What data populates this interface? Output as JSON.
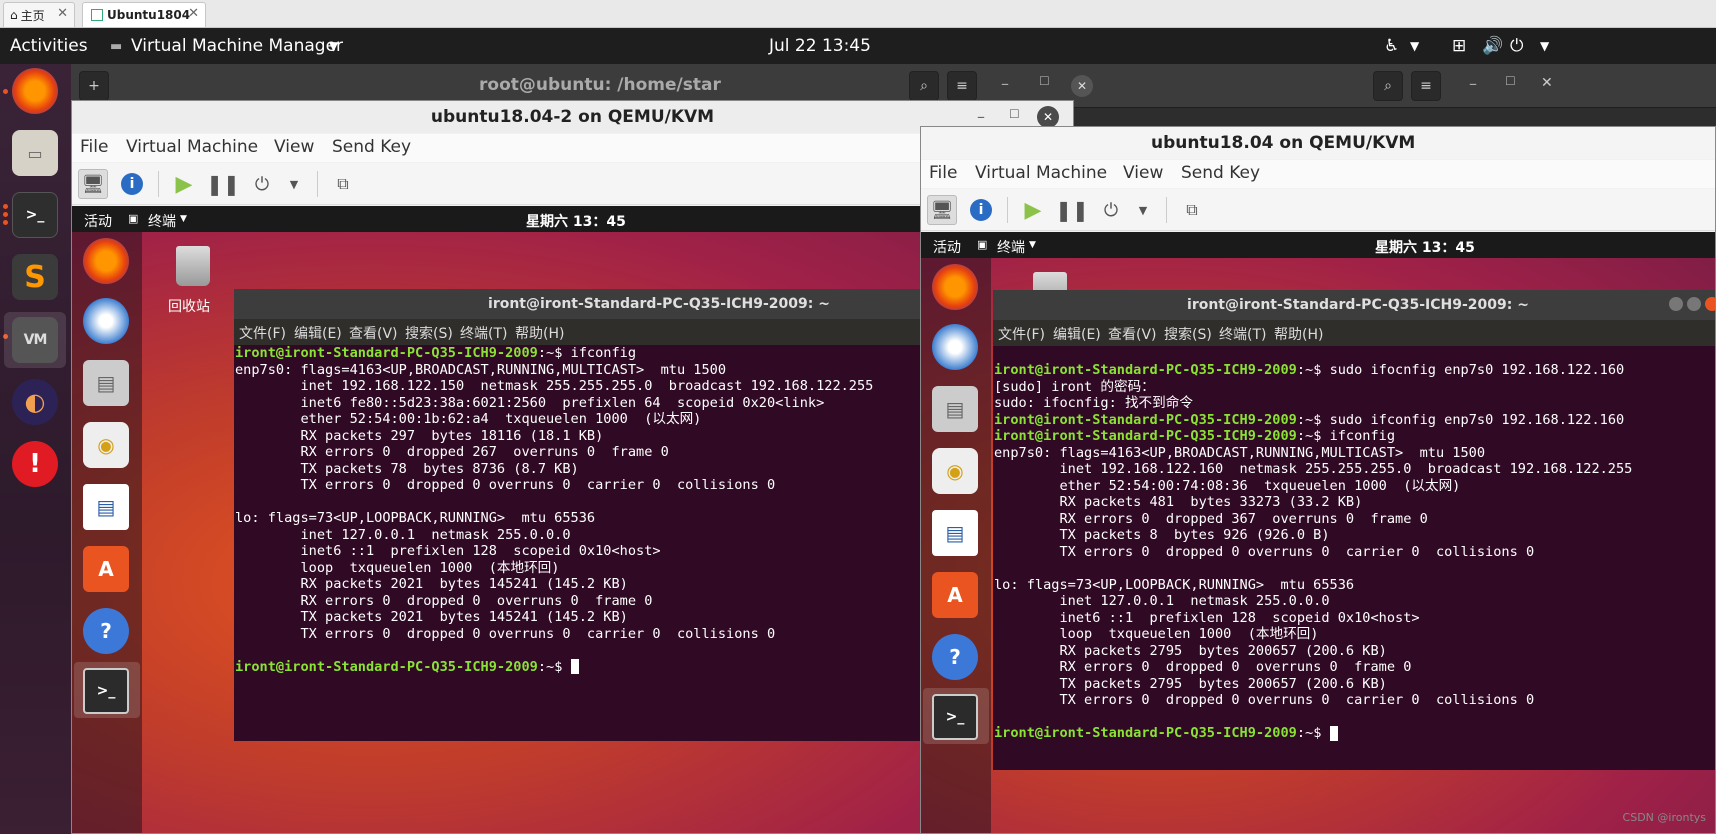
{
  "browser_tabs": [
    {
      "label": "主页"
    },
    {
      "label": "Ubuntu1804"
    }
  ],
  "topbar": {
    "activities": "Activities",
    "app": "Virtual Machine Manager",
    "clock": "Jul 22  13:45"
  },
  "bg_terminal": {
    "title": "root@ubuntu: /home/star"
  },
  "vm_left": {
    "title": "ubuntu18.04-2 on QEMU/KVM",
    "menu": [
      "File",
      "Virtual Machine",
      "View",
      "Send Key"
    ],
    "guest": {
      "activities": "活动",
      "app": "终端",
      "clock": "星期六 13：45",
      "trash_label": "回收站",
      "terminal": {
        "title": "iront@iront-Standard-PC-Q35-ICH9-2009: ~",
        "menu": [
          "文件(F)",
          "编辑(E)",
          "查看(V)",
          "搜索(S)",
          "终端(T)",
          "帮助(H)"
        ],
        "prompt": "iront@iront-Standard-PC-Q35-ICH9-2009",
        "lines": [
          {
            "p": "iront@iront-Standard-PC-Q35-ICH9-2009",
            "t": ":~$ ifconfig"
          },
          {
            "t": "enp7s0: flags=4163<UP,BROADCAST,RUNNING,MULTICAST>  mtu 1500"
          },
          {
            "t": "        inet 192.168.122.150  netmask 255.255.255.0  broadcast 192.168.122.255"
          },
          {
            "t": "        inet6 fe80::5d23:38a:6021:2560  prefixlen 64  scopeid 0x20<link>"
          },
          {
            "t": "        ether 52:54:00:1b:62:a4  txqueuelen 1000  (以太网)"
          },
          {
            "t": "        RX packets 297  bytes 18116 (18.1 KB)"
          },
          {
            "t": "        RX errors 0  dropped 267  overruns 0  frame 0"
          },
          {
            "t": "        TX packets 78  bytes 8736 (8.7 KB)"
          },
          {
            "t": "        TX errors 0  dropped 0 overruns 0  carrier 0  collisions 0"
          },
          {
            "t": ""
          },
          {
            "t": "lo: flags=73<UP,LOOPBACK,RUNNING>  mtu 65536"
          },
          {
            "t": "        inet 127.0.0.1  netmask 255.0.0.0"
          },
          {
            "t": "        inet6 ::1  prefixlen 128  scopeid 0x10<host>"
          },
          {
            "t": "        loop  txqueuelen 1000  (本地环回)"
          },
          {
            "t": "        RX packets 2021  bytes 145241 (145.2 KB)"
          },
          {
            "t": "        RX errors 0  dropped 0  overruns 0  frame 0"
          },
          {
            "t": "        TX packets 2021  bytes 145241 (145.2 KB)"
          },
          {
            "t": "        TX errors 0  dropped 0 overruns 0  carrier 0  collisions 0"
          },
          {
            "t": ""
          },
          {
            "p": "iront@iront-Standard-PC-Q35-ICH9-2009",
            "t": ":~$ ",
            "cursor": true
          }
        ]
      }
    }
  },
  "vm_right": {
    "title": "ubuntu18.04 on QEMU/KVM",
    "menu": [
      "File",
      "Virtual Machine",
      "View",
      "Send Key"
    ],
    "guest": {
      "activities": "活动",
      "app": "终端",
      "clock": "星期六 13：45",
      "terminal": {
        "title": "iront@iront-Standard-PC-Q35-ICH9-2009: ~",
        "menu": [
          "文件(F)",
          "编辑(E)",
          "查看(V)",
          "搜索(S)",
          "终端(T)",
          "帮助(H)"
        ],
        "lines": [
          {
            "p": "iront@iront-Standard-PC-Q35-ICH9-2009",
            "t": ":~$ sudo ifocnfig enp7s0 192.168.122.160"
          },
          {
            "t": "[sudo] iront 的密码："
          },
          {
            "t": "sudo: ifocnfig: 找不到命令"
          },
          {
            "p": "iront@iront-Standard-PC-Q35-ICH9-2009",
            "t": ":~$ sudo ifconfig enp7s0 192.168.122.160"
          },
          {
            "p": "iront@iront-Standard-PC-Q35-ICH9-2009",
            "t": ":~$ ifconfig"
          },
          {
            "t": "enp7s0: flags=4163<UP,BROADCAST,RUNNING,MULTICAST>  mtu 1500"
          },
          {
            "t": "        inet 192.168.122.160  netmask 255.255.255.0  broadcast 192.168.122.255"
          },
          {
            "t": "        ether 52:54:00:74:08:36  txqueuelen 1000  (以太网)"
          },
          {
            "t": "        RX packets 481  bytes 33273 (33.2 KB)"
          },
          {
            "t": "        RX errors 0  dropped 367  overruns 0  frame 0"
          },
          {
            "t": "        TX packets 8  bytes 926 (926.0 B)"
          },
          {
            "t": "        TX errors 0  dropped 0 overruns 0  carrier 0  collisions 0"
          },
          {
            "t": ""
          },
          {
            "t": "lo: flags=73<UP,LOOPBACK,RUNNING>  mtu 65536"
          },
          {
            "t": "        inet 127.0.0.1  netmask 255.0.0.0"
          },
          {
            "t": "        inet6 ::1  prefixlen 128  scopeid 0x10<host>"
          },
          {
            "t": "        loop  txqueuelen 1000  (本地环回)"
          },
          {
            "t": "        RX packets 2795  bytes 200657 (200.6 KB)"
          },
          {
            "t": "        RX errors 0  dropped 0  overruns 0  frame 0"
          },
          {
            "t": "        TX packets 2795  bytes 200657 (200.6 KB)"
          },
          {
            "t": "        TX errors 0  dropped 0 overruns 0  carrier 0  collisions 0"
          },
          {
            "t": ""
          },
          {
            "p": "iront@iront-Standard-PC-Q35-ICH9-2009",
            "t": ":~$ ",
            "cursor": true
          }
        ]
      }
    }
  },
  "watermark": "CSDN @irontys"
}
